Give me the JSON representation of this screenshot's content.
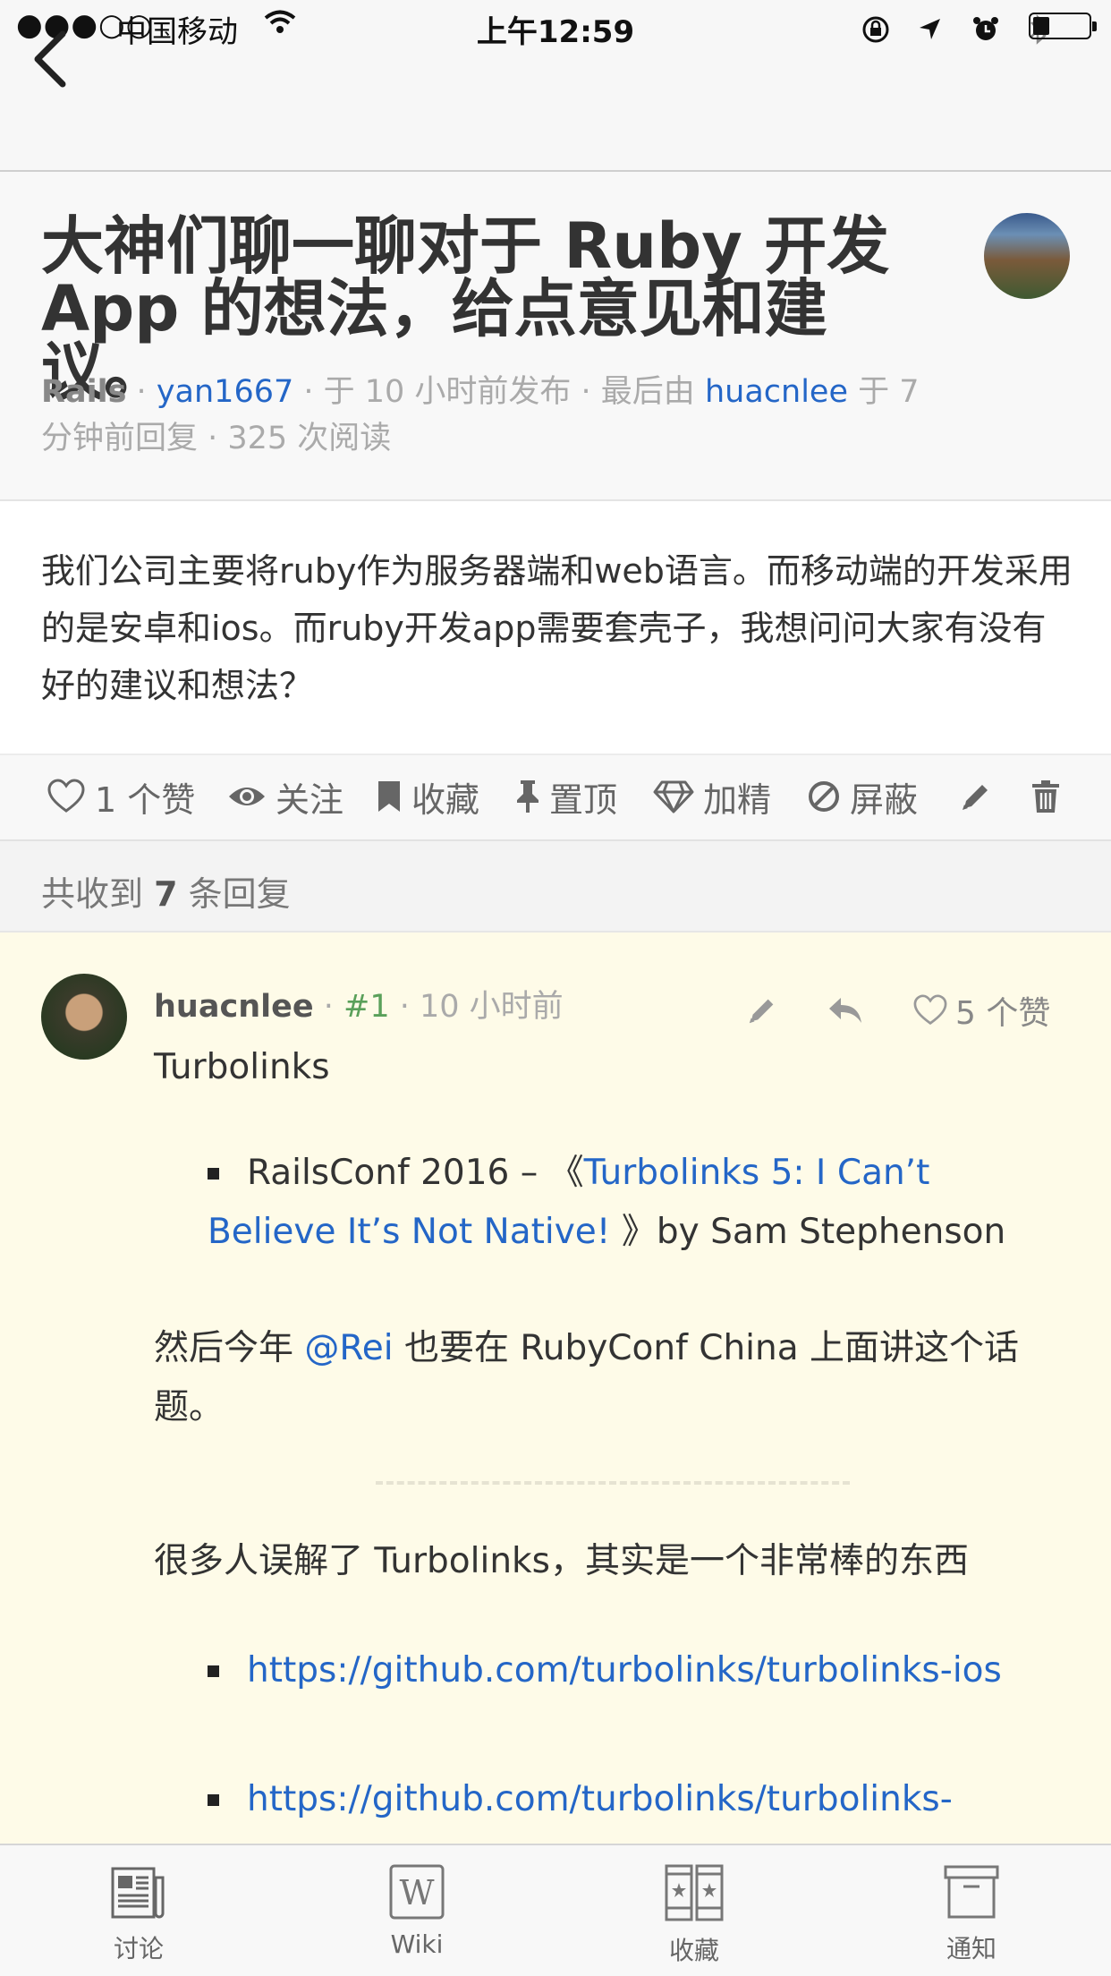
{
  "status_bar": {
    "signal": "●●●○○",
    "carrier": "中国移动",
    "time": "上午12:59",
    "battery_level": 0.3
  },
  "nav": {
    "back_icon": "chevron-left-icon"
  },
  "topic": {
    "title": "大神们聊一聊对于 Ruby 开发 App 的想法，给点意见和建议。",
    "node": "Rails",
    "author": "yan1667",
    "published": "· 于 10 小时前发布 · 最后由",
    "last_replier": "huacnlee",
    "replied": "于 7 分钟前回复 · 325 次阅读",
    "sep": "·",
    "body": "我们公司主要将ruby作为服务器端和web语言。而移动端的开发采用的是安卓和ios。而ruby开发app需要套壳子，我想问问大家有没有好的建议和想法？"
  },
  "actions": {
    "like": "1 个赞",
    "follow": "关注",
    "favorite": "收藏",
    "pin": "置顶",
    "excellent": "加精",
    "block": "屏蔽"
  },
  "replies": {
    "prefix": "共收到",
    "count": "7",
    "suffix": "条回复"
  },
  "reply": {
    "user": "huacnlee",
    "floor": "#1",
    "time": "· 10 小时前",
    "likes": "5 个赞",
    "line1": "Turbolinks",
    "item1_prefix": "RailsConf 2016 – 《",
    "item1_link": "Turbolinks 5: I Can’t Believe It’s Not Native!",
    "item1_suffix": " 》by Sam Stephenson",
    "para2_prefix": "然后今年 ",
    "para2_mention": "@Rei",
    "para2_suffix": " 也要在 RubyConf China 上面讲这个话题。",
    "para3": "很多人误解了 Turbolinks，其实是一个非常棒的东西",
    "link1": "https://github.com/turbolinks/turbolinks-ios",
    "link2": "https://github.com/turbolinks/turbolinks-"
  },
  "tabs": [
    {
      "label": "讨论",
      "icon": "newspaper-icon"
    },
    {
      "label": "Wiki",
      "icon": "wiki-icon"
    },
    {
      "label": "收藏",
      "icon": "bookmarks-icon"
    },
    {
      "label": "通知",
      "icon": "inbox-icon"
    }
  ]
}
